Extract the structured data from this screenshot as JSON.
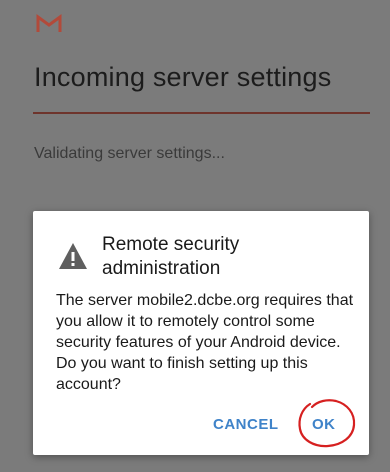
{
  "app": {
    "logo_icon": "gmail-m-icon",
    "brand_color": "#b24a3a"
  },
  "header": {
    "title": "Incoming server settings"
  },
  "status": {
    "text": "Validating server settings..."
  },
  "dialog": {
    "icon": "warning-icon",
    "title": "Remote security administration",
    "message": "The server mobile2.dcbe.org requires that you allow it to remotely control some security features of your Android device. Do you want to finish setting up this account?",
    "cancel_label": "CANCEL",
    "ok_label": "OK",
    "button_color": "#3f83c9",
    "annotation_color": "#d62020"
  }
}
